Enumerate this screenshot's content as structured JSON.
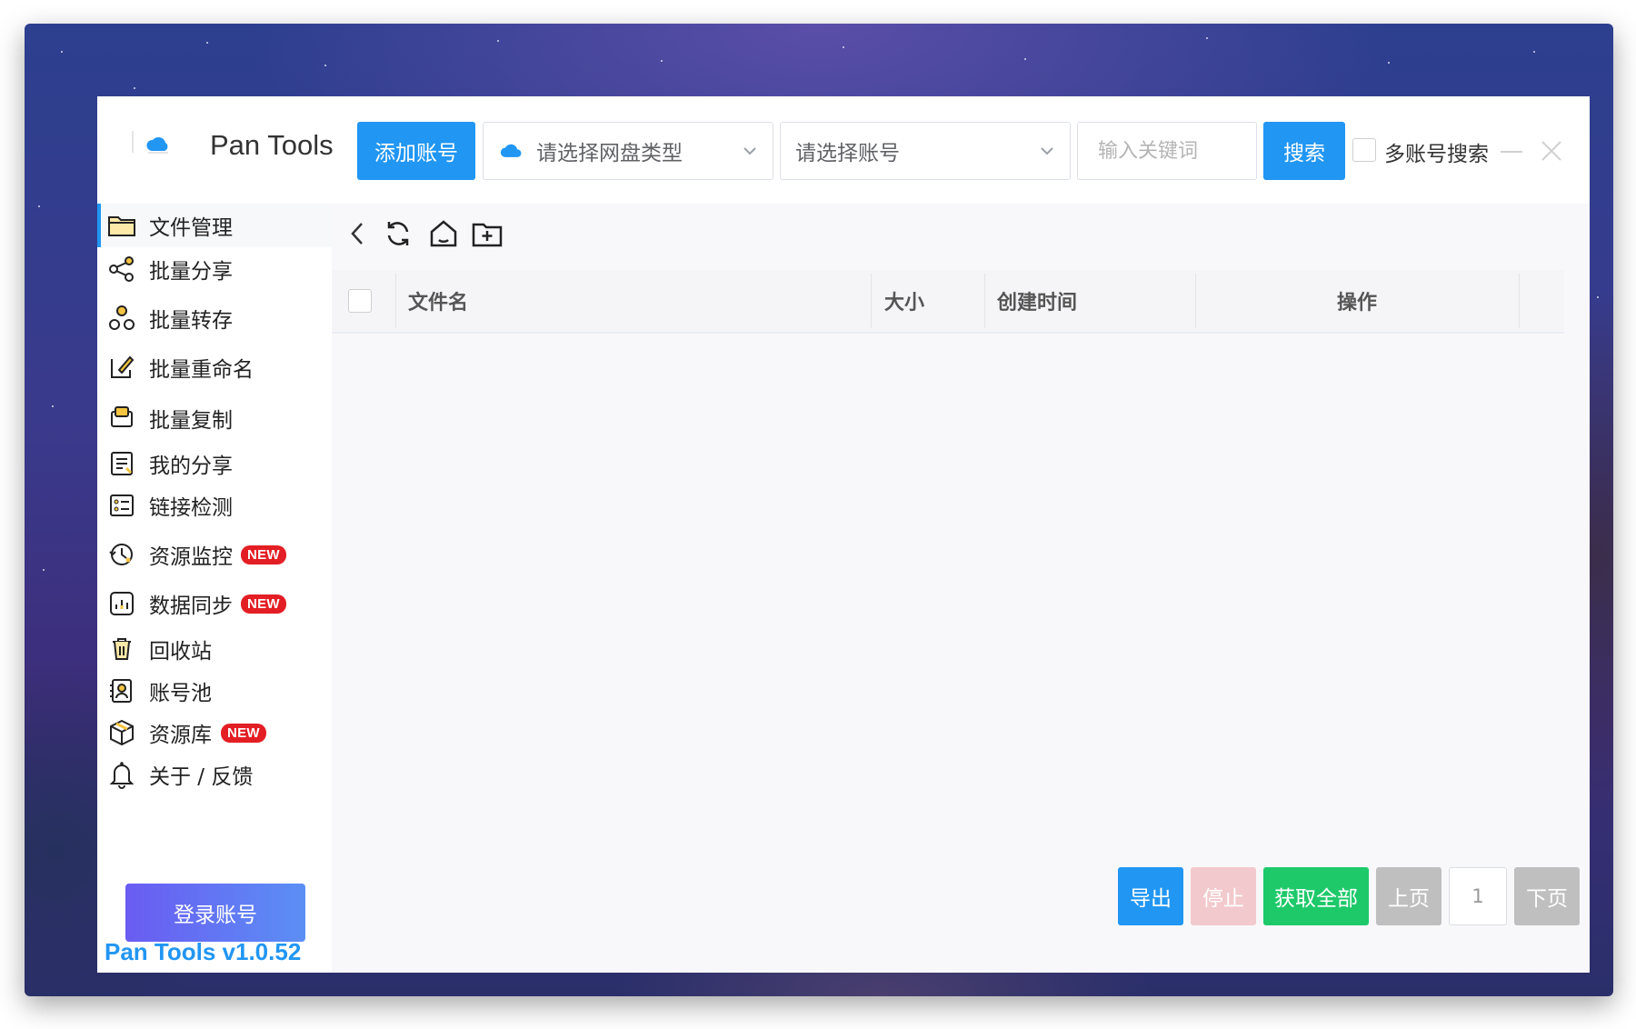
{
  "app": {
    "title": "Pan Tools",
    "version": "Pan Tools v1.0.52"
  },
  "header": {
    "add_account_label": "添加账号",
    "disk_type_placeholder": "请选择网盘类型",
    "account_placeholder": "请选择账号",
    "keyword_placeholder": "输入关键词",
    "search_label": "搜索",
    "multi_account_label": "多账号搜索"
  },
  "sidebar": {
    "items": [
      {
        "label": "文件管理",
        "icon": "folder-icon",
        "active": true
      },
      {
        "label": "批量分享",
        "icon": "share-icon"
      },
      {
        "label": "批量转存",
        "icon": "transfer-icon"
      },
      {
        "label": "批量重命名",
        "icon": "rename-icon"
      },
      {
        "label": "批量复制",
        "icon": "copy-icon"
      },
      {
        "label": "我的分享",
        "icon": "my-share-icon"
      },
      {
        "label": "链接检测",
        "icon": "link-check-icon"
      },
      {
        "label": "资源监控",
        "icon": "monitor-icon",
        "badge": "NEW"
      },
      {
        "label": "数据同步",
        "icon": "sync-chart-icon",
        "badge": "NEW"
      },
      {
        "label": "回收站",
        "icon": "trash-icon"
      },
      {
        "label": "账号池",
        "icon": "account-pool-icon"
      },
      {
        "label": "资源库",
        "icon": "resource-box-icon",
        "badge": "NEW"
      },
      {
        "label": "关于 / 反馈",
        "icon": "bell-icon"
      }
    ],
    "login_label": "登录账号"
  },
  "toolbar": {
    "icons": [
      "back-icon",
      "refresh-icon",
      "home-icon",
      "new-folder-icon"
    ]
  },
  "table": {
    "columns": [
      "文件名",
      "大小",
      "创建时间",
      "操作"
    ],
    "rows": []
  },
  "footer": {
    "export_label": "导出",
    "stop_label": "停止",
    "fetch_all_label": "获取全部",
    "prev_label": "上页",
    "page_number": "1",
    "next_label": "下页"
  },
  "colors": {
    "primary": "#2196f3",
    "success": "#1ec96a",
    "badge_red": "#e31e24",
    "stop_disabled": "#f2c9cc",
    "pager_disabled": "#bfbfbf"
  }
}
